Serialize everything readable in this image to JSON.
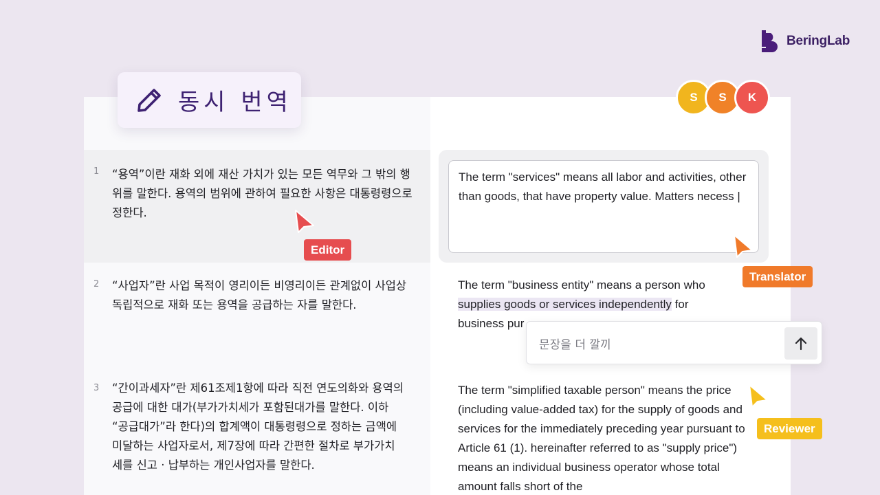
{
  "brand": {
    "name": "BeringLab",
    "color": "#4a1d7a"
  },
  "mode": {
    "title": "동시 번역",
    "icon": "pencil-icon"
  },
  "collaborators": [
    {
      "initial": "S",
      "color": "#f1b51e"
    },
    {
      "initial": "S",
      "color": "#f08228"
    },
    {
      "initial": "K",
      "color": "#ee5550"
    }
  ],
  "segments": [
    {
      "number": "1",
      "source": "“용역”이란 재화 외에 재산 가치가 있는 모든 역무와 그 밖의 행위를 말한다. 용역의 범위에 관하여 필요한 사항은 대통령령으로 정한다.",
      "target": "The term \"services\" means all labor and activities, other than goods, that have property value. Matters necess |"
    },
    {
      "number": "2",
      "source": "“사업자”란 사업 목적이 영리이든 비영리이든 관계없이 사업상 독립적으로 재화 또는 용역을 공급하는 자를 말한다.",
      "target_line1": "The term \"business entity\" means a person who",
      "target_highlight": "supplies goods or services independently",
      "target_after": " for",
      "target_line3": "business pur"
    },
    {
      "number": "3",
      "source": "“간이과세자”란 제61조제1항에 따라 직전 연도의화와 용역의 공급에 대한 대가(부가가치세가 포함된대가를 말한다. 이하 “공급대가”라 한다)의 합계액이 대통령령으로 정하는 금액에 미달하는 사업자로서, 제7장에 따라 간편한 절차로 부가가치세를 신고 · 납부하는 개인사업자를 말한다.",
      "target": "The term \"simplified taxable person\" means the price (including value-added tax) for the supply of goods and services for the immediately preceding year pursuant to Article 61 (1). hereinafter referred to as \"supply price\") means an individual business operator whose total amount falls short of the"
    }
  ],
  "roles": {
    "editor": {
      "label": "Editor",
      "color": "#e64d4f"
    },
    "translator": {
      "label": "Translator",
      "color": "#f07a2a"
    },
    "reviewer": {
      "label": "Reviewer",
      "color": "#f5bf1c"
    }
  },
  "chat": {
    "value": "문장을 더 깔끼",
    "send_icon": "arrow-up-icon"
  }
}
